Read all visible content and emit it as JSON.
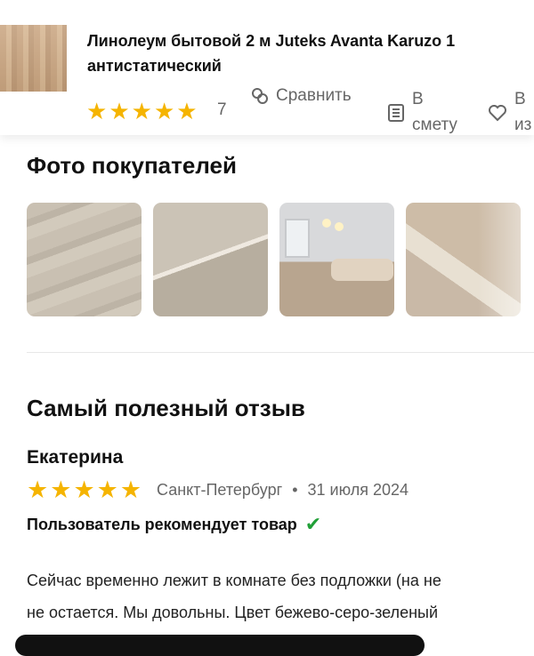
{
  "product": {
    "title_line1": "Линолеум бытовой 2 м Juteks Avanta Karuzo 1",
    "title_line2": "антистатический",
    "rating_stars": 5,
    "rating_count": "7",
    "compare_label": "Сравнить",
    "estimate_label_line1": "В",
    "estimate_label_line2": "смету",
    "favorite_label_line1": "В",
    "favorite_label_line2": "из"
  },
  "photos_section": {
    "title": "Фото покупателей",
    "photos": [
      "customer-photo-1",
      "customer-photo-2",
      "customer-photo-3",
      "customer-photo-4"
    ]
  },
  "review_section": {
    "title": "Самый полезный отзыв",
    "author": "Екатерина",
    "stars": 5,
    "location": "Санкт-Петербург",
    "separator": "•",
    "date": "31 июля 2024",
    "recommendation": "Пользователь рекомендует товар",
    "text_line1": "Сейчас временно лежит в комнате без подложки (на не",
    "text_line2": "не остается. Мы довольны. Цвет бежево-серо-зеленый"
  },
  "colors": {
    "star": "#f5b400",
    "check": "#21a038",
    "muted_text": "#666666"
  },
  "icons": {
    "compare": "compare-icon",
    "estimate": "estimate-list-icon",
    "favorite": "heart-icon",
    "check": "check-icon",
    "star": "star-icon"
  }
}
